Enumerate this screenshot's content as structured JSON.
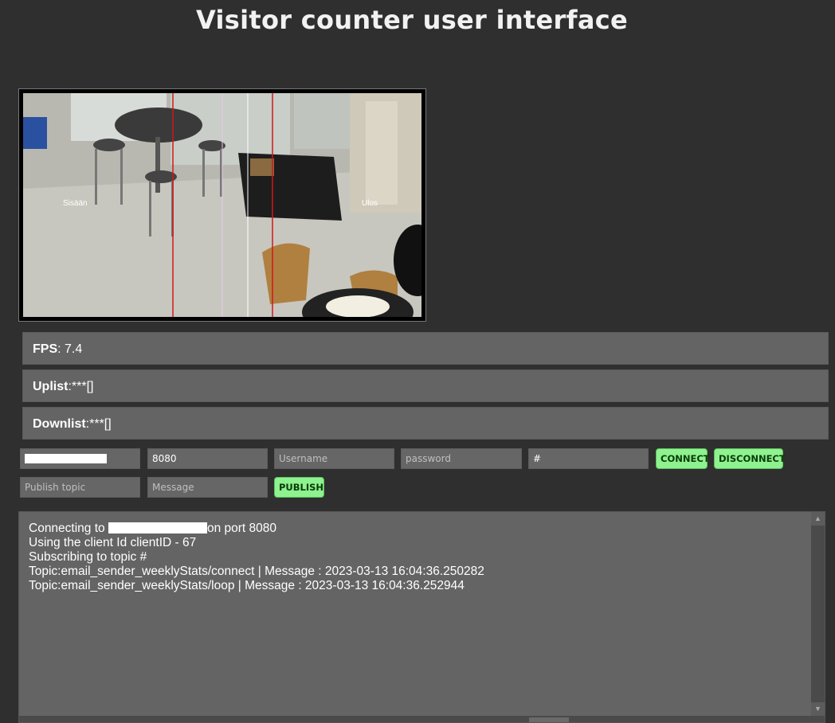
{
  "app": {
    "title": "Visitor counter user interface"
  },
  "camera": {
    "left_label": "Sisään",
    "right_label": "Ulos"
  },
  "stats": {
    "fps_label": "FPS",
    "fps_value": ": 7.4",
    "uplist_label": "Uplist",
    "uplist_value": ":***[]",
    "downlist_label": "Downlist",
    "downlist_value": ":***[]"
  },
  "connection": {
    "port_value": "8080",
    "username_placeholder": "Username",
    "password_placeholder": "password",
    "topic_value": "#",
    "connect_label": "CONNECT",
    "disconnect_label": "DISCONNECT"
  },
  "publish": {
    "topic_placeholder": "Publish topic",
    "message_placeholder": "Message",
    "publish_label": "PUBLISH"
  },
  "log": {
    "line1_prefix": "Connecting to ",
    "line1_suffix": "on port 8080",
    "lines": [
      "Using the client Id clientID - 67",
      "Subscribing to topic #",
      "Topic:email_sender_weeklyStats/connect | Message : 2023-03-13 16:04:36.250282",
      "Topic:email_sender_weeklyStats/loop | Message : 2023-03-13 16:04:36.252944"
    ]
  },
  "colors": {
    "background": "#2f2f2f",
    "panel": "#646464",
    "button_green": "#8ef28e",
    "counting_line_red": "#d01818"
  }
}
